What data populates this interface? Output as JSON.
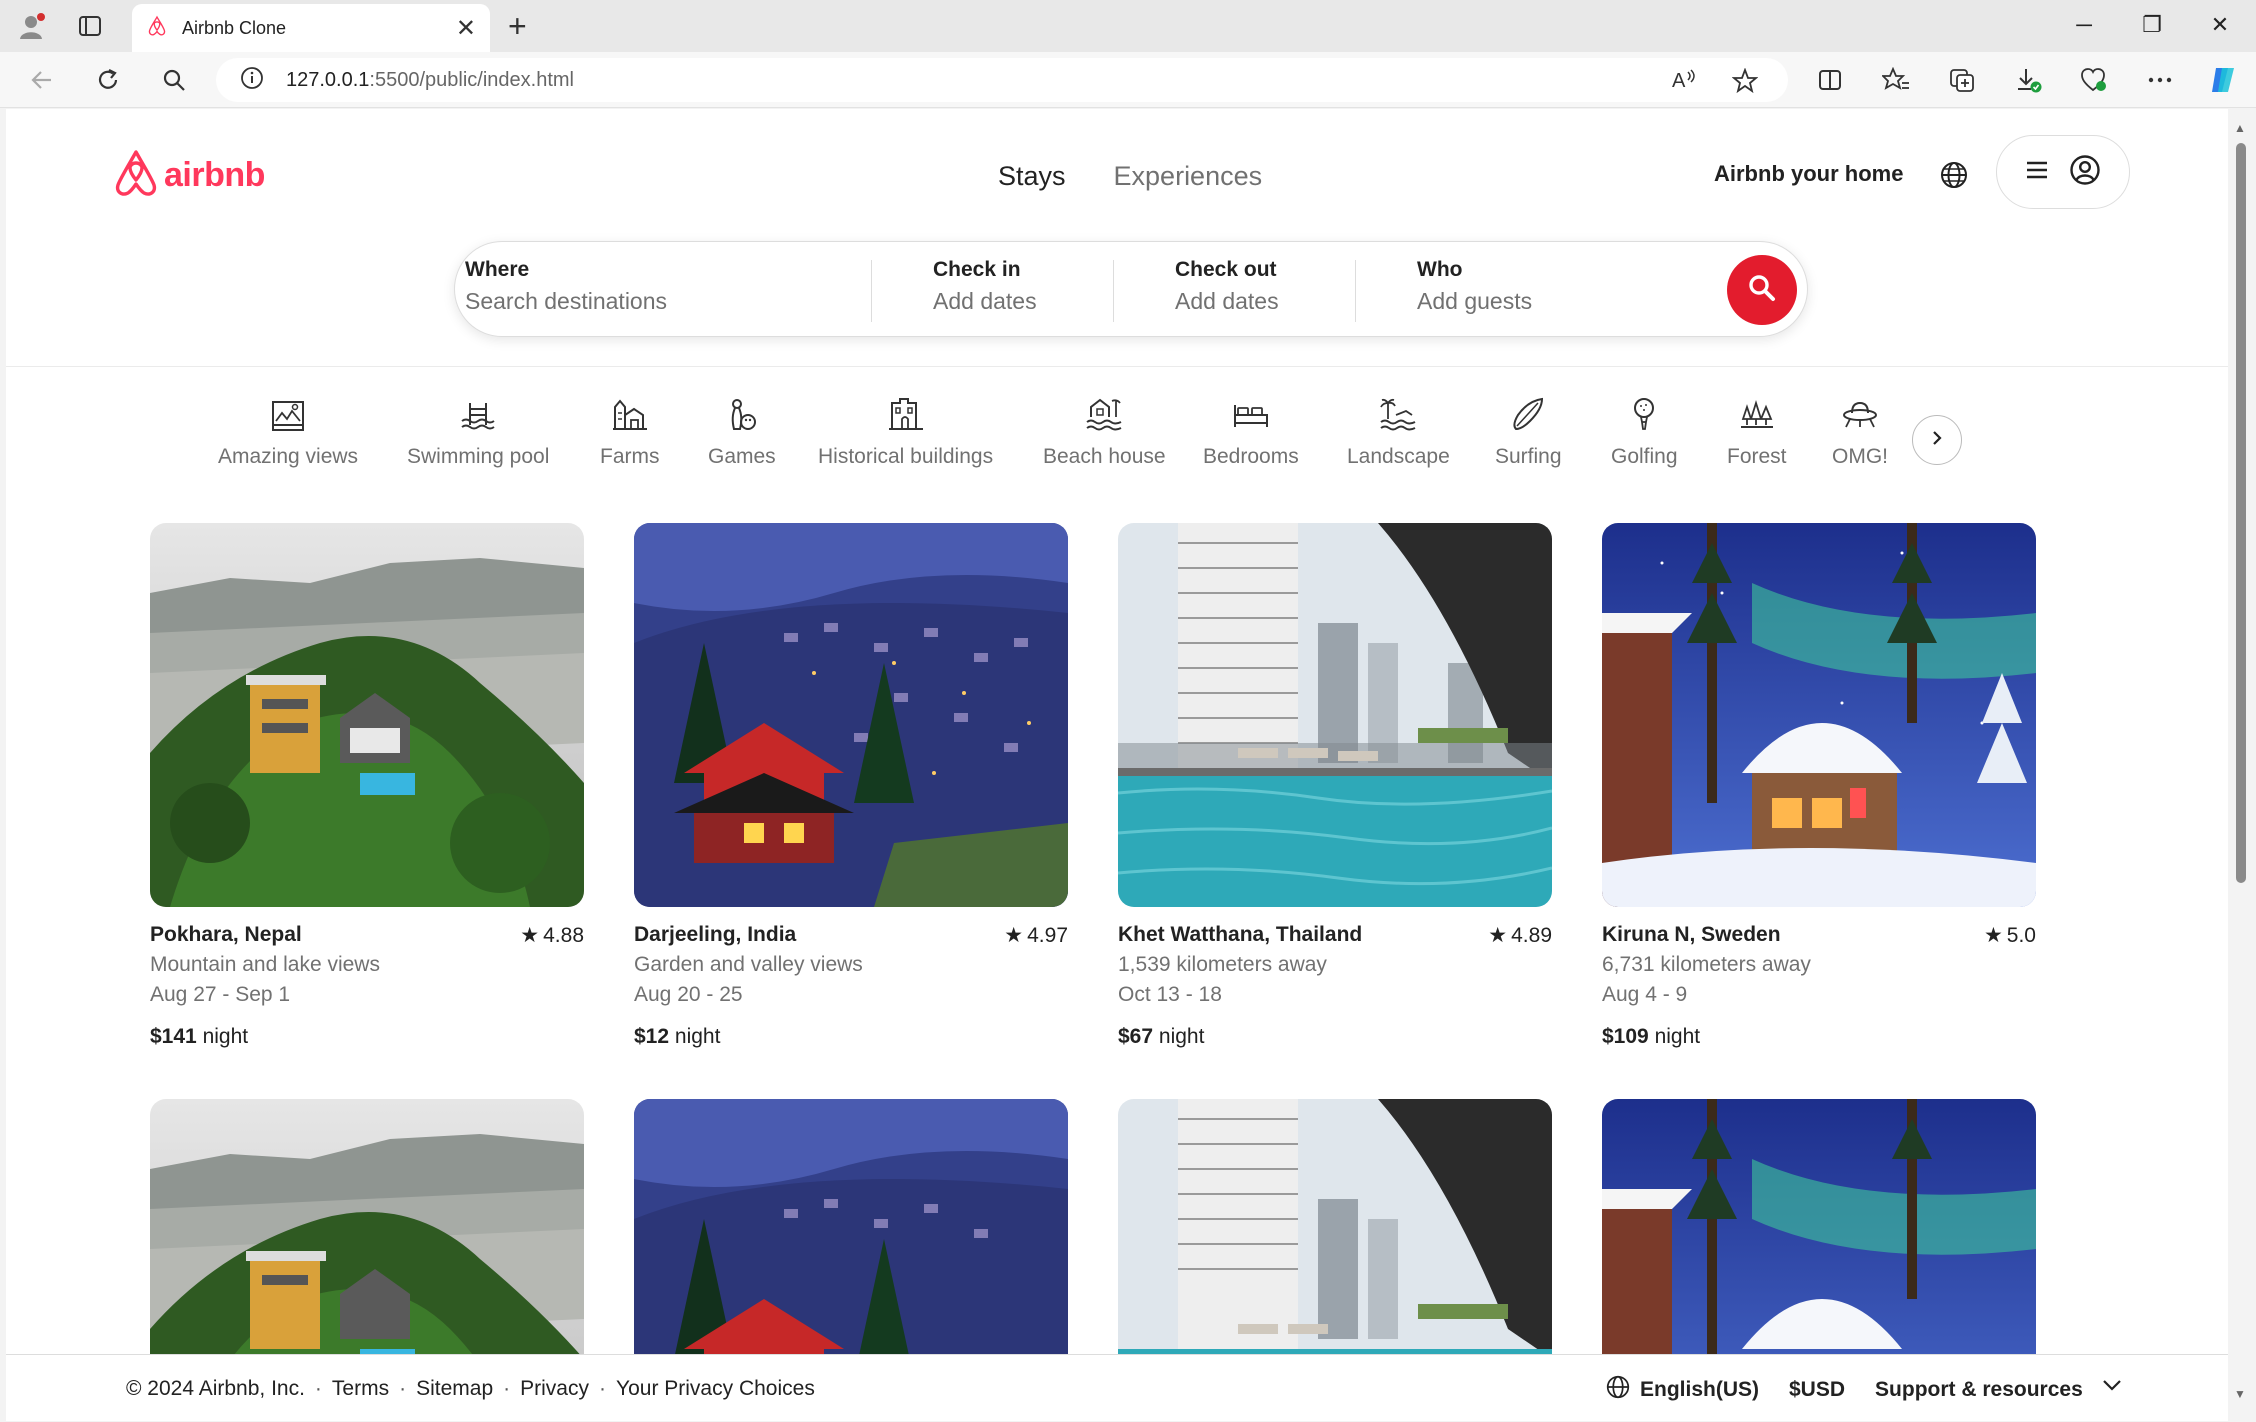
{
  "browser": {
    "tab_title": "Airbnb Clone",
    "url_host": "127.0.0.1",
    "url_rest": ":5500/public/index.html"
  },
  "header": {
    "logo_text": "airbnb",
    "nav": [
      "Stays",
      "Experiences"
    ],
    "host_link": "Airbnb your home"
  },
  "search": {
    "where": {
      "label": "Where",
      "placeholder": "Search destinations"
    },
    "checkin": {
      "label": "Check in",
      "placeholder": "Add dates"
    },
    "checkout": {
      "label": "Check out",
      "placeholder": "Add dates"
    },
    "who": {
      "label": "Who",
      "placeholder": "Add guests"
    }
  },
  "categories": [
    {
      "label": "Amazing views",
      "icon": "amazing-views-icon"
    },
    {
      "label": "Swimming pool",
      "icon": "swimming-pool-icon"
    },
    {
      "label": "Farms",
      "icon": "farms-icon"
    },
    {
      "label": "Games",
      "icon": "games-icon"
    },
    {
      "label": "Historical buildings",
      "icon": "historical-buildings-icon"
    },
    {
      "label": "Beach house",
      "icon": "beach-house-icon"
    },
    {
      "label": "Bedrooms",
      "icon": "bedrooms-icon"
    },
    {
      "label": "Landscape",
      "icon": "landscape-icon"
    },
    {
      "label": "Surfing",
      "icon": "surfing-icon"
    },
    {
      "label": "Golfing",
      "icon": "golfing-icon"
    },
    {
      "label": "Forest",
      "icon": "forest-icon"
    },
    {
      "label": "OMG!",
      "icon": "omg-icon"
    }
  ],
  "listings": [
    {
      "location": "Pokhara, Nepal",
      "rating": "4.88",
      "subtitle": "Mountain and lake views",
      "dates": "Aug 27 - Sep 1",
      "price": "$141",
      "price_unit": "night"
    },
    {
      "location": "Darjeeling, India",
      "rating": "4.97",
      "subtitle": "Garden and valley views",
      "dates": "Aug 20 - 25",
      "price": "$12",
      "price_unit": "night"
    },
    {
      "location": "Khet Watthana, Thailand",
      "rating": "4.89",
      "subtitle": "1,539 kilometers away",
      "dates": "Oct 13 - 18",
      "price": "$67",
      "price_unit": "night"
    },
    {
      "location": "Kiruna N, Sweden",
      "rating": "5.0",
      "subtitle": "6,731 kilometers away",
      "dates": "Aug 4 - 9",
      "price": "$109",
      "price_unit": "night"
    }
  ],
  "footer": {
    "copyright": "© 2024 Airbnb, Inc.",
    "links": [
      "Terms",
      "Sitemap",
      "Privacy",
      "Your Privacy Choices"
    ],
    "language": "English(US)",
    "currency": "$USD",
    "support": "Support & resources"
  },
  "colors": {
    "brand": "#ff385c",
    "search_button": "#e31c2d"
  }
}
